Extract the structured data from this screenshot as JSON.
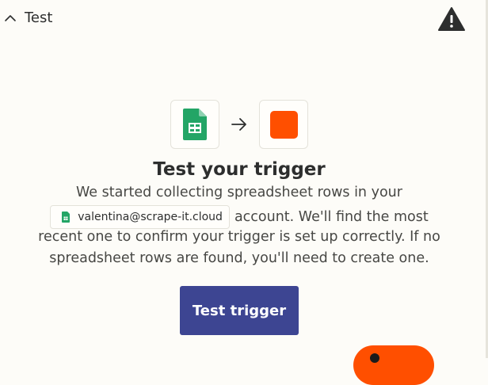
{
  "header": {
    "title": "Test",
    "collapse_icon": "chevron-up-icon",
    "alert_icon": "warning-triangle-icon"
  },
  "apps": {
    "trigger_app_icon": "google-sheets-icon",
    "connector_icon": "arrow-right-icon",
    "action_app_icon": "orange-square-icon"
  },
  "main": {
    "title": "Test your trigger",
    "line1": "We started collecting spreadsheet rows in your",
    "account_email": "valentina@scrape-it.cloud",
    "line2_suffix": "account. We'll find the most",
    "line3": "recent one to confirm your trigger is set up correctly. If no",
    "line4": "spreadsheet rows are found, you'll need to create one.",
    "test_button_label": "Test trigger"
  },
  "colors": {
    "background": "#fdfcf8",
    "primary_button": "#3d4592",
    "accent_orange": "#ff4f00",
    "sheets_green": "#23a566"
  }
}
